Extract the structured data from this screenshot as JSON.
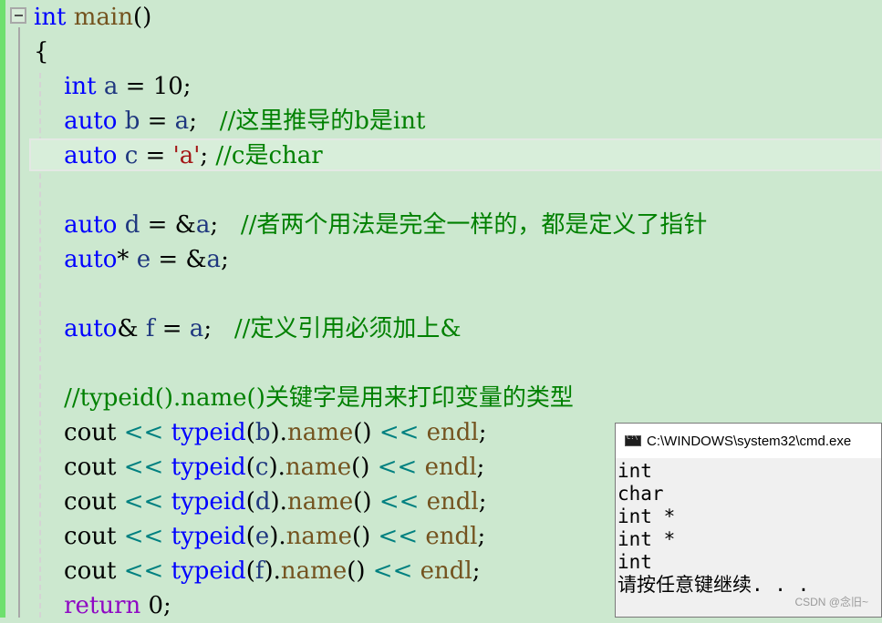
{
  "editor": {
    "lines": [
      [
        {
          "t": "int",
          "c": "kw"
        },
        {
          "t": " "
        },
        {
          "t": "main",
          "c": "fn"
        },
        {
          "t": "()"
        }
      ],
      [
        {
          "t": "{"
        }
      ],
      [
        {
          "t": "    "
        },
        {
          "t": "int",
          "c": "kw"
        },
        {
          "t": " "
        },
        {
          "t": "a",
          "c": "var"
        },
        {
          "t": " = "
        },
        {
          "t": "10",
          "c": "num"
        },
        {
          "t": ";"
        }
      ],
      [
        {
          "t": "    "
        },
        {
          "t": "auto",
          "c": "kw"
        },
        {
          "t": " "
        },
        {
          "t": "b",
          "c": "var"
        },
        {
          "t": " = "
        },
        {
          "t": "a",
          "c": "var"
        },
        {
          "t": ";   "
        },
        {
          "t": "//这里推导的b是int",
          "c": "cmt"
        }
      ],
      [
        {
          "t": "    "
        },
        {
          "t": "auto",
          "c": "kw"
        },
        {
          "t": " "
        },
        {
          "t": "c",
          "c": "var"
        },
        {
          "t": " = "
        },
        {
          "t": "'a'",
          "c": "str"
        },
        {
          "t": "; "
        },
        {
          "t": "//c是char",
          "c": "cmt"
        }
      ],
      [
        {
          "t": ""
        }
      ],
      [
        {
          "t": "    "
        },
        {
          "t": "auto",
          "c": "kw"
        },
        {
          "t": " "
        },
        {
          "t": "d",
          "c": "var"
        },
        {
          "t": " = &"
        },
        {
          "t": "a",
          "c": "var"
        },
        {
          "t": ";   "
        },
        {
          "t": "//者两个用法是完全一样的，都是定义了指针",
          "c": "cmt"
        }
      ],
      [
        {
          "t": "    "
        },
        {
          "t": "auto",
          "c": "kw"
        },
        {
          "t": "* "
        },
        {
          "t": "e",
          "c": "var"
        },
        {
          "t": " = &"
        },
        {
          "t": "a",
          "c": "var"
        },
        {
          "t": ";"
        }
      ],
      [
        {
          "t": ""
        }
      ],
      [
        {
          "t": "    "
        },
        {
          "t": "auto",
          "c": "kw"
        },
        {
          "t": "& "
        },
        {
          "t": "f",
          "c": "var"
        },
        {
          "t": " = "
        },
        {
          "t": "a",
          "c": "var"
        },
        {
          "t": ";   "
        },
        {
          "t": "//定义引用必须加上&",
          "c": "cmt"
        }
      ],
      [
        {
          "t": ""
        }
      ],
      [
        {
          "t": "    "
        },
        {
          "t": "//typeid().name()关键字是用来打印变量的类型",
          "c": "cmt"
        }
      ],
      [
        {
          "t": "    cout "
        },
        {
          "t": "<<",
          "c": "op"
        },
        {
          "t": " "
        },
        {
          "t": "typeid",
          "c": "kw"
        },
        {
          "t": "("
        },
        {
          "t": "b",
          "c": "var"
        },
        {
          "t": ")."
        },
        {
          "t": "name",
          "c": "fn"
        },
        {
          "t": "() "
        },
        {
          "t": "<<",
          "c": "op"
        },
        {
          "t": " "
        },
        {
          "t": "endl",
          "c": "fn"
        },
        {
          "t": ";"
        }
      ],
      [
        {
          "t": "    cout "
        },
        {
          "t": "<<",
          "c": "op"
        },
        {
          "t": " "
        },
        {
          "t": "typeid",
          "c": "kw"
        },
        {
          "t": "("
        },
        {
          "t": "c",
          "c": "var"
        },
        {
          "t": ")."
        },
        {
          "t": "name",
          "c": "fn"
        },
        {
          "t": "() "
        },
        {
          "t": "<<",
          "c": "op"
        },
        {
          "t": " "
        },
        {
          "t": "endl",
          "c": "fn"
        },
        {
          "t": ";"
        }
      ],
      [
        {
          "t": "    cout "
        },
        {
          "t": "<<",
          "c": "op"
        },
        {
          "t": " "
        },
        {
          "t": "typeid",
          "c": "kw"
        },
        {
          "t": "("
        },
        {
          "t": "d",
          "c": "var"
        },
        {
          "t": ")."
        },
        {
          "t": "name",
          "c": "fn"
        },
        {
          "t": "() "
        },
        {
          "t": "<<",
          "c": "op"
        },
        {
          "t": " "
        },
        {
          "t": "endl",
          "c": "fn"
        },
        {
          "t": ";"
        }
      ],
      [
        {
          "t": "    cout "
        },
        {
          "t": "<<",
          "c": "op"
        },
        {
          "t": " "
        },
        {
          "t": "typeid",
          "c": "kw"
        },
        {
          "t": "("
        },
        {
          "t": "e",
          "c": "var"
        },
        {
          "t": ")."
        },
        {
          "t": "name",
          "c": "fn"
        },
        {
          "t": "() "
        },
        {
          "t": "<<",
          "c": "op"
        },
        {
          "t": " "
        },
        {
          "t": "endl",
          "c": "fn"
        },
        {
          "t": ";"
        }
      ],
      [
        {
          "t": "    cout "
        },
        {
          "t": "<<",
          "c": "op"
        },
        {
          "t": " "
        },
        {
          "t": "typeid",
          "c": "kw"
        },
        {
          "t": "("
        },
        {
          "t": "f",
          "c": "var"
        },
        {
          "t": ")."
        },
        {
          "t": "name",
          "c": "fn"
        },
        {
          "t": "() "
        },
        {
          "t": "<<",
          "c": "op"
        },
        {
          "t": " "
        },
        {
          "t": "endl",
          "c": "fn"
        },
        {
          "t": ";"
        }
      ],
      [
        {
          "t": "    "
        },
        {
          "t": "return",
          "c": "ret"
        },
        {
          "t": " 0;"
        }
      ]
    ],
    "current_line_index": 4,
    "fold_icon": "collapse-minus-icon"
  },
  "console": {
    "title": "C:\\WINDOWS\\system32\\cmd.exe",
    "icon": "cmd-icon",
    "output": [
      "int",
      "char",
      "int *",
      "int *",
      "int",
      "请按任意键继续. . ."
    ],
    "watermark": "CSDN @念旧~"
  },
  "colors": {
    "editor_bg": "#cce8cf",
    "keyword": "#0000ff",
    "comment": "#008000",
    "string": "#a31515",
    "function": "#74531f",
    "return_keyword": "#8f08c4",
    "operator": "#008080"
  }
}
